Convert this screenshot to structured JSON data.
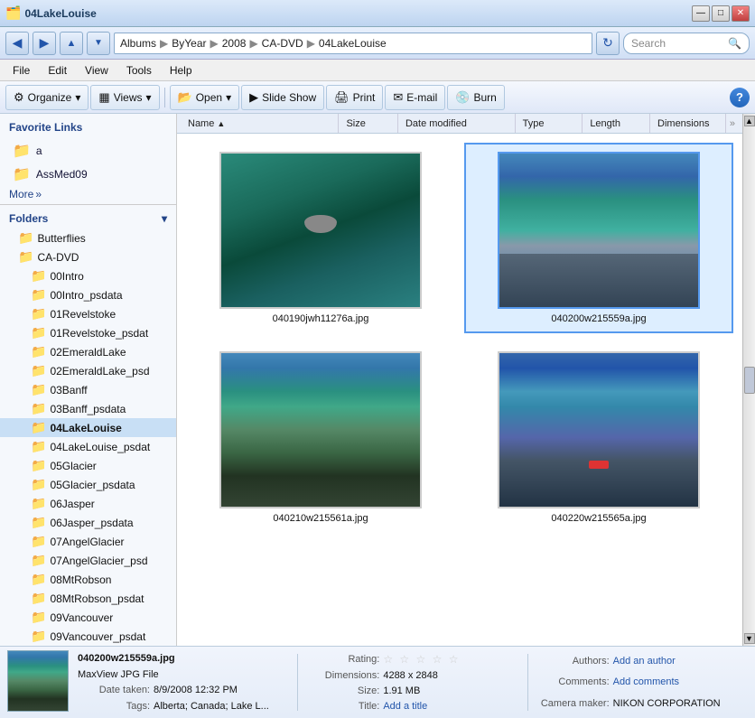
{
  "titlebar": {
    "title": "04LakeLouise",
    "min_label": "—",
    "max_label": "□",
    "close_label": "✕"
  },
  "addressbar": {
    "back_tooltip": "Back",
    "forward_tooltip": "Forward",
    "path_parts": [
      "Albums",
      "ByYear",
      "2008",
      "CA-DVD",
      "04LakeLouise"
    ],
    "search_placeholder": "Search"
  },
  "menubar": {
    "items": [
      "File",
      "Edit",
      "View",
      "Tools",
      "Help"
    ]
  },
  "toolbar": {
    "organize_label": "Organize",
    "views_label": "Views",
    "open_label": "Open",
    "slideshow_label": "Slide Show",
    "print_label": "Print",
    "email_label": "E-mail",
    "burn_label": "Burn",
    "help_label": "?"
  },
  "sidebar": {
    "fav_title": "Favorite Links",
    "fav_items": [
      {
        "label": "a"
      },
      {
        "label": "AssMed09"
      }
    ],
    "more_label": "More",
    "folders_title": "Folders",
    "folder_items": [
      {
        "label": "Butterflies",
        "indent": 1,
        "active": false
      },
      {
        "label": "CA-DVD",
        "indent": 1,
        "active": false
      },
      {
        "label": "00Intro",
        "indent": 2,
        "active": false
      },
      {
        "label": "00Intro_psdata",
        "indent": 2,
        "active": false
      },
      {
        "label": "01Revelstoke",
        "indent": 2,
        "active": false
      },
      {
        "label": "01Revelstoke_psdat",
        "indent": 2,
        "active": false
      },
      {
        "label": "02EmeraldLake",
        "indent": 2,
        "active": false
      },
      {
        "label": "02EmeraldLake_psd",
        "indent": 2,
        "active": false
      },
      {
        "label": "03Banff",
        "indent": 2,
        "active": false
      },
      {
        "label": "03Banff_psdata",
        "indent": 2,
        "active": false
      },
      {
        "label": "04LakeLouise",
        "indent": 2,
        "active": true
      },
      {
        "label": "04LakeLouise_psdat",
        "indent": 2,
        "active": false
      },
      {
        "label": "05Glacier",
        "indent": 2,
        "active": false
      },
      {
        "label": "05Glacier_psdata",
        "indent": 2,
        "active": false
      },
      {
        "label": "06Jasper",
        "indent": 2,
        "active": false
      },
      {
        "label": "06Jasper_psdata",
        "indent": 2,
        "active": false
      },
      {
        "label": "07AngelGlacier",
        "indent": 2,
        "active": false
      },
      {
        "label": "07AngelGlacier_psd",
        "indent": 2,
        "active": false
      },
      {
        "label": "08MtRobson",
        "indent": 2,
        "active": false
      },
      {
        "label": "08MtRobson_psdat",
        "indent": 2,
        "active": false
      },
      {
        "label": "09Vancouver",
        "indent": 2,
        "active": false
      },
      {
        "label": "09Vancouver_psdat",
        "indent": 2,
        "active": false
      }
    ]
  },
  "columns": {
    "name": "Name",
    "size": "Size",
    "date_modified": "Date modified",
    "type": "Type",
    "length": "Length",
    "dimensions": "Dimensions"
  },
  "images": [
    {
      "filename": "040190jwh11276a.jpg",
      "selected": false
    },
    {
      "filename": "040200w215559a.jpg",
      "selected": true
    },
    {
      "filename": "040210w215561a.jpg",
      "selected": false
    },
    {
      "filename": "040220w215565a.jpg",
      "selected": false
    }
  ],
  "statusbar": {
    "filename": "040200w215559a.jpg",
    "filetype": "MaxView JPG File",
    "date_taken_label": "Date taken:",
    "date_taken": "8/9/2008 12:32 PM",
    "tags_label": "Tags:",
    "tags": "Alberta; Canada; Lake L...",
    "rating_label": "Rating:",
    "rating_stars": "★★★★★",
    "dimensions_label": "Dimensions:",
    "dimensions": "4288 x 2848",
    "size_label": "Size:",
    "size": "1.91 MB",
    "title_label": "Title:",
    "title_add": "Add a title",
    "authors_label": "Authors:",
    "authors_add": "Add an author",
    "comments_label": "Comments:",
    "comments_add": "Add comments",
    "camera_label": "Camera maker:",
    "camera": "NIKON CORPORATION"
  }
}
